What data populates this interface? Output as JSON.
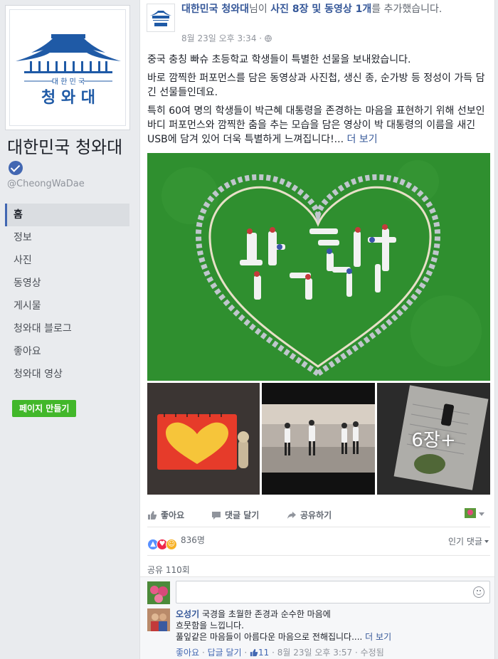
{
  "page": {
    "name": "대한민국 청와대",
    "handle": "@CheongWaDae",
    "logo_text_top": "대 한 민 국",
    "logo_text_main": "청 와 대"
  },
  "nav": {
    "items": [
      {
        "label": "홈",
        "active": true
      },
      {
        "label": "정보"
      },
      {
        "label": "사진"
      },
      {
        "label": "동영상"
      },
      {
        "label": "게시물"
      },
      {
        "label": "청와대 블로그"
      },
      {
        "label": "좋아요"
      },
      {
        "label": "청와대 영상"
      }
    ],
    "create_page_label": "페이지 만들기"
  },
  "post": {
    "author": "대한민국 청와대",
    "header_mid": "님이 ",
    "header_link": "사진 8장 및 동영상 1개",
    "header_tail": "를 추가했습니다.",
    "time": "8월 23일 오후 3:34 · ",
    "paragraphs": [
      "중국 충칭 빠슈 초등학교 학생들이 특별한 선물을 보내왔습니다.",
      "바로 깜찍한 퍼포먼스를 담은 동영상과 사진첩, 생신 종, 순가방 등 정성이 가득 담긴 선물들인데요.",
      "특히 60여 명의 학생들이 박근혜 대통령을 존경하는 마음을 표현하기 위해 선보인 바디 퍼포먼스와 깜찍한 춤을 추는 모습을 담은 영상이 박 대통령의 이름을 새긴 USB에 담겨 있어 더욱 특별하게 느껴집니다!..."
    ],
    "see_more": "더 보기",
    "more_photos": "6장+"
  },
  "actions": {
    "like": "좋아요",
    "comment": "댓글 달기",
    "share": "공유하기"
  },
  "reactions": {
    "count": "836명",
    "sort_label": "인기 댓글"
  },
  "shares": "공유 110회",
  "comment": {
    "author": "오성기",
    "text1": " 국경을 초월한 존경과 순수한 마음에",
    "text2": "흐뭇함을 느낍니다.",
    "text3": "풀잎같은 마음들이 아름다운 마음으로 전해집니다.... ",
    "see_more": "더 보기",
    "like": "좋아요",
    "reply": "답글 달기",
    "sep": " · ",
    "likes": "11",
    "time": " · 8월 23일 오후 3:57 · 수정됨"
  },
  "colors": {
    "brand_blue": "#4267b2",
    "link": "#365899",
    "green_button": "#42b72a",
    "logo_blue": "#1f5aa6"
  }
}
